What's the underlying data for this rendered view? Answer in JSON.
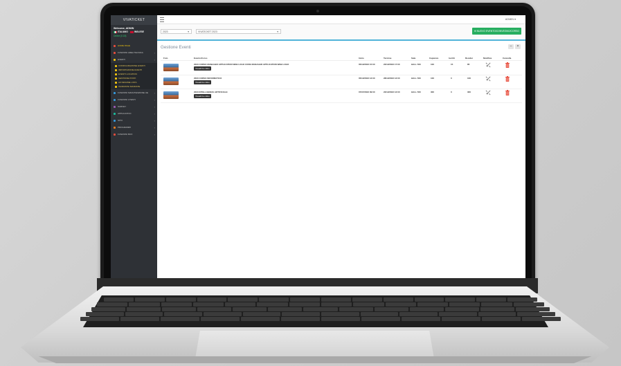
{
  "sidebar": {
    "brand": "VIVATICKET",
    "welcome": "Welcome, ADMIN",
    "languages": [
      "ITALIANO",
      "INGLESE"
    ],
    "status": "Online (0.18)",
    "items": [
      {
        "label": "HOME PAGE",
        "color": "#e74c3c",
        "active": true
      },
      {
        "label": "FUNZIONI AREA TECNICA",
        "color": "#e74c3c",
        "active": false,
        "chevron": true
      },
      {
        "label": "EVENTI",
        "color": "#f1c40f",
        "active": false,
        "chevron": true
      },
      {
        "label": "FUNZIONI MANUTENZIONE UE",
        "color": "#3498db",
        "active": false,
        "chevron": true
      },
      {
        "label": "FUNZIONI UTENTI",
        "color": "#3498db",
        "active": false,
        "chevron": true
      },
      {
        "label": "SURVEY",
        "color": "#9b59b6",
        "active": false,
        "chevron": true
      },
      {
        "label": "APPLICATIVO",
        "color": "#1abc9c",
        "active": false,
        "chevron": true
      },
      {
        "label": "SITO",
        "color": "#3498db",
        "active": false,
        "chevron": true
      },
      {
        "label": "PROGRAMMI",
        "color": "#e67e22",
        "active": false,
        "chevron": true
      },
      {
        "label": "FUNZIONI BOX",
        "color": "#e74c3c",
        "active": false,
        "chevron": true
      }
    ],
    "eventi_sub": [
      {
        "label": "CONFIGURAZIONE EVENTI",
        "color": "#f1c40f"
      },
      {
        "label": "IMPORTAZIONE EVENTI",
        "color": "#f1c40f"
      },
      {
        "label": "EVENTI LOCATION",
        "color": "#f1c40f"
      },
      {
        "label": "GESTIONE POSTI",
        "color": "#f1c40f"
      },
      {
        "label": "AZ RESUME LISTA",
        "color": "#f1c40f"
      },
      {
        "label": "ISCRIZIONI MANDATE",
        "color": "#f1c40f"
      }
    ]
  },
  "topbar": {
    "user": "ADMIN ▾"
  },
  "filters": {
    "year": "2023",
    "edition": "VIVATICKET 2023",
    "new_button": "NUOVO EVENTO/CONVEGNO/CORSO"
  },
  "panel": {
    "title": "Gestione Eventi",
    "minimize": "–",
    "close": "×"
  },
  "table": {
    "headers": [
      "Foto",
      "Evento/Corso",
      "Inizio",
      "Termine",
      "Sala",
      "Capienza",
      "Iscritti",
      "Residui",
      "Modifica",
      "Cancella"
    ],
    "view_label": "Visualizza online",
    "rows": [
      {
        "name": "2023 CORSO MANAGER APPLICATION WEB LOGO CODE MANAGER APPLICATION WEB LOGO",
        "start": "05/12/2023 15:00",
        "end": "22/12/2023 17:00",
        "room": "HALL 500",
        "capacity": "100",
        "enrolled": "15",
        "remaining": "85"
      },
      {
        "name": "2023 CORSO INFORMATICO",
        "start": "05/12/2023 13:00",
        "end": "28/12/2023 13:00",
        "room": "HALL 500",
        "capacity": "100",
        "enrolled": "0",
        "remaining": "100"
      },
      {
        "name": "2023 INTELLIGENZA ARTIFICIALE",
        "start": "07/07/2023 09:00",
        "end": "22/12/2023 13:00",
        "room": "HALL 500",
        "capacity": "300",
        "enrolled": "0",
        "remaining": "300"
      }
    ]
  },
  "colors": {
    "accent": "#4fb3d9",
    "success": "#27ae60",
    "danger": "#e74c3c",
    "sidebar": "#2e3136"
  }
}
